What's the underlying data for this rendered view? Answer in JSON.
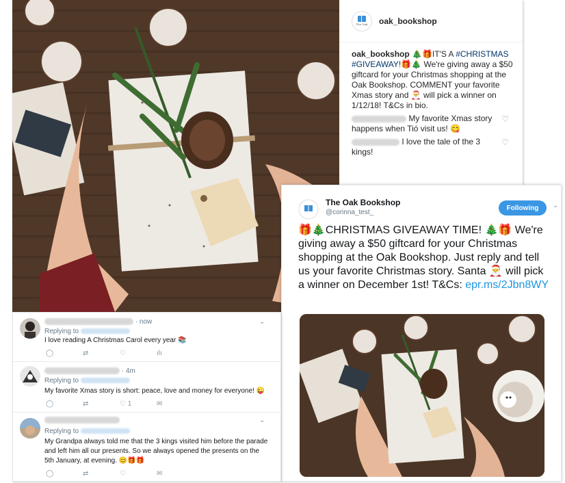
{
  "instagram": {
    "username": "oak_bookshop",
    "logo_text": "The Oak",
    "caption_user": "oak_bookshop",
    "caption_text_1": " 🎄🎁IT'S A ",
    "caption_tag_1": "#CHRISTMAS",
    "caption_tag_2": "#GIVEAWAY",
    "caption_text_2": "!🎁🎄 We're giving away a $50 giftcard for your Christmas shopping at the Oak Bookshop. COMMENT your favorite Xmas story and 🎅 will pick a winner on 1/12/18! T&Cs in bio.",
    "comments": [
      {
        "text": "My favorite Xmas story happens when Tió visit us! 😋"
      },
      {
        "text": "I love the tale of the 3 kings!"
      }
    ]
  },
  "tweet": {
    "name": "The Oak Bookshop",
    "handle": "@corinna_test_",
    "follow_label": "Following",
    "text": "🎁🎄CHRISTMAS GIVEAWAY TIME! 🎄🎁 We're giving away a $50 giftcard for your Christmas shopping at the Oak Bookshop. Just reply and tell us your favorite Christmas story. Santa 🎅 will pick a winner on December 1st! T&Cs: ",
    "link": "epr.ms/2Jbn8WY"
  },
  "replies": [
    {
      "time": "· now",
      "replying": "Replying to",
      "text": "I love reading A Christmas Carol every year 📚",
      "likes": ""
    },
    {
      "time": "· 4m",
      "replying": "Replying to",
      "text": "My favorite Xmas story is short: peace, love and money for everyone! 😜",
      "likes": "1"
    },
    {
      "time": "",
      "replying": "Replying to",
      "text": "My Grandpa always told me that the 3 kings visited him before the parade and left him all our presents. So we always opened the presents on the 5th January, at evening. 😊🎁🎁",
      "likes": ""
    }
  ],
  "colors": {
    "link": "#1b95e0",
    "follow_bg": "#3b96e3",
    "ig_tag": "#003569"
  }
}
